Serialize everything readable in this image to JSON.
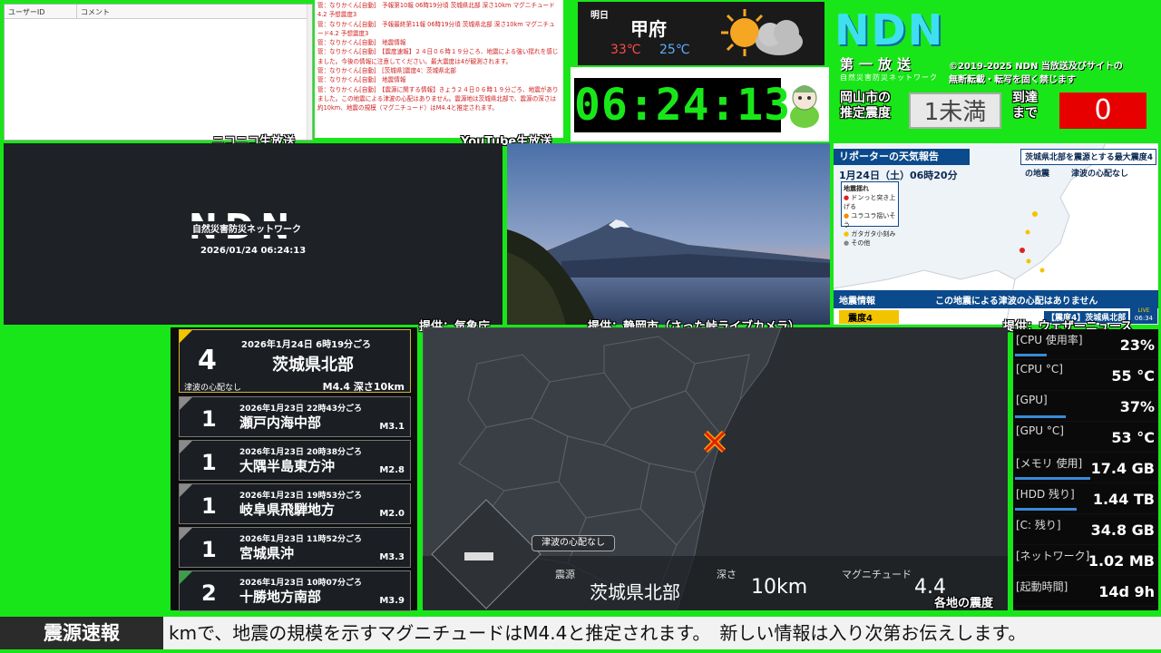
{
  "nico": {
    "col_user": "ユーザーID",
    "col_comment": "コメント",
    "caption": "ニコニコ生放送"
  },
  "youtube": {
    "caption": "YouTube生放送",
    "comments": [
      "管：なりかくん[自動]　予報第10報 06時19分頃 茨城県北部 深さ10km マグニチュード4.2 予想震度3",
      "管：なりかくん[自動]　予報最終第11報 06時19分頃 茨城県北部 深さ10km マグニチュード4.2 予想震度3",
      "管：なりかくん[自動]　地震情報",
      "管：なりかくん[自動]　【震度速報】２４日０６時１９分ころ、地震による強い揺れを感じました。今後の情報に注意してください。最大震度は4が観測されます。",
      "管：なりかくん[自動]　[茨城県]震度4：茨城県北部",
      "管：なりかくん[自動]　地震情報",
      "管：なりかくん[自動]　【震源に関する情報】きょう２４日０６時１９分ごろ、地震がありました。この地震による津波の心配はありません。震源地は茨城県北部で、震源の深さは約10km、地震の規模（マグニチュード）はM4.4と推定されます。"
    ]
  },
  "weather": {
    "day": "明日",
    "city": "甲府",
    "high": "33℃",
    "low": "25℃",
    "icon": "sun-cloud-icon"
  },
  "clock": {
    "time": "06:24:13"
  },
  "brand": {
    "logo": "NDN",
    "sub1": "第一放送",
    "sub2": "自然災害防災ネットワーク",
    "copyright_line1": "©2019-2025 NDN 当放送及びサイトの",
    "copyright_line2": "無断転載・転写を固く禁じます"
  },
  "estimate": {
    "label_line1": "岡山市の",
    "label_line2": "推定震度",
    "value": "1未満",
    "until_line1": "到達",
    "until_line2": "まで",
    "countdown": "0"
  },
  "ndn_panel": {
    "logo": "NDN",
    "tagline": "自然災害防災ネットワーク",
    "timestamp": "2026/01/24 06:24:13",
    "credit": "提供：気象庁"
  },
  "camera": {
    "credit": "提供：静岡市（さった峠ライブカメラ）"
  },
  "weathernews": {
    "title": "リポーターの天気報告",
    "date": "1月24日（土）06時20分",
    "headline": "茨城県北部を震源とする最大震度4の地震",
    "tsunami": "津波の心配なし",
    "legend_title": "地震揺れ",
    "legend": [
      "ドンっと突き上げる",
      "ユラユラ揺いそう",
      "ガタガタ小刻み",
      "その他"
    ],
    "bottom_label": "地震情報",
    "bottom_msg": "この地震による津波の心配はありません",
    "bottom_intensity": "震度4",
    "bottom_area": "【震度4】茨城県北部",
    "live": "LIVE",
    "live_time": "06:34",
    "credit": "提供：ウェザーニュース"
  },
  "quakes": [
    {
      "intensity": "4",
      "datetime": "2026年1月24日 6時19分ごろ",
      "place": "茨城県北部",
      "tsunami": "津波の心配なし",
      "mag_depth": "M4.4 深さ10km"
    },
    {
      "intensity": "1",
      "datetime": "2026年1月23日 22時43分ごろ",
      "place": "瀬戸内海中部",
      "mag": "M3.1"
    },
    {
      "intensity": "1",
      "datetime": "2026年1月23日 20時38分ごろ",
      "place": "大隅半島東方沖",
      "mag": "M2.8"
    },
    {
      "intensity": "1",
      "datetime": "2026年1月23日 19時53分ごろ",
      "place": "岐阜県飛騨地方",
      "mag": "M2.0"
    },
    {
      "intensity": "1",
      "datetime": "2026年1月23日 11時52分ごろ",
      "place": "宮城県沖",
      "mag": "M3.3"
    },
    {
      "intensity": "2",
      "datetime": "2026年1月23日 10時07分ごろ",
      "place": "十勝地方南部",
      "mag": "M3.9"
    }
  ],
  "map": {
    "tsunami_badge": "津波の心配なし",
    "epicenter_label": "震源",
    "epicenter": "茨城県北部",
    "depth_label": "深さ",
    "depth": "10km",
    "mag_label": "マグニチュード",
    "mag": "4.4",
    "title": "各地の震度",
    "legend_value": "ー"
  },
  "system": [
    {
      "key": "[CPU 使用率]",
      "value": "23%",
      "bar": 0.23
    },
    {
      "key": "[CPU °C]",
      "value": "55 °C",
      "bar": 0
    },
    {
      "key": "[GPU]",
      "value": "37%",
      "bar": 0.37
    },
    {
      "key": "[GPU °C]",
      "value": "53 °C",
      "bar": 0
    },
    {
      "key": "[メモリ 使用]",
      "value": "17.4 GB",
      "bar": 0.55
    },
    {
      "key": "[HDD 残り]",
      "value": "1.44 TB",
      "bar": 0.45
    },
    {
      "key": "[C: 残り]",
      "value": "34.8 GB",
      "bar": 0
    },
    {
      "key": "[ネットワーク]",
      "value": "1.02 MB",
      "bar": 0
    },
    {
      "key": "[起動時間]",
      "value": "14d 9h",
      "bar": 0
    }
  ],
  "ticker": {
    "label": "震源速報",
    "text": "kmで、地震の規模を示すマグニチュードはM4.4と推定されます。　新しい情報は入り次第お伝えします。"
  }
}
